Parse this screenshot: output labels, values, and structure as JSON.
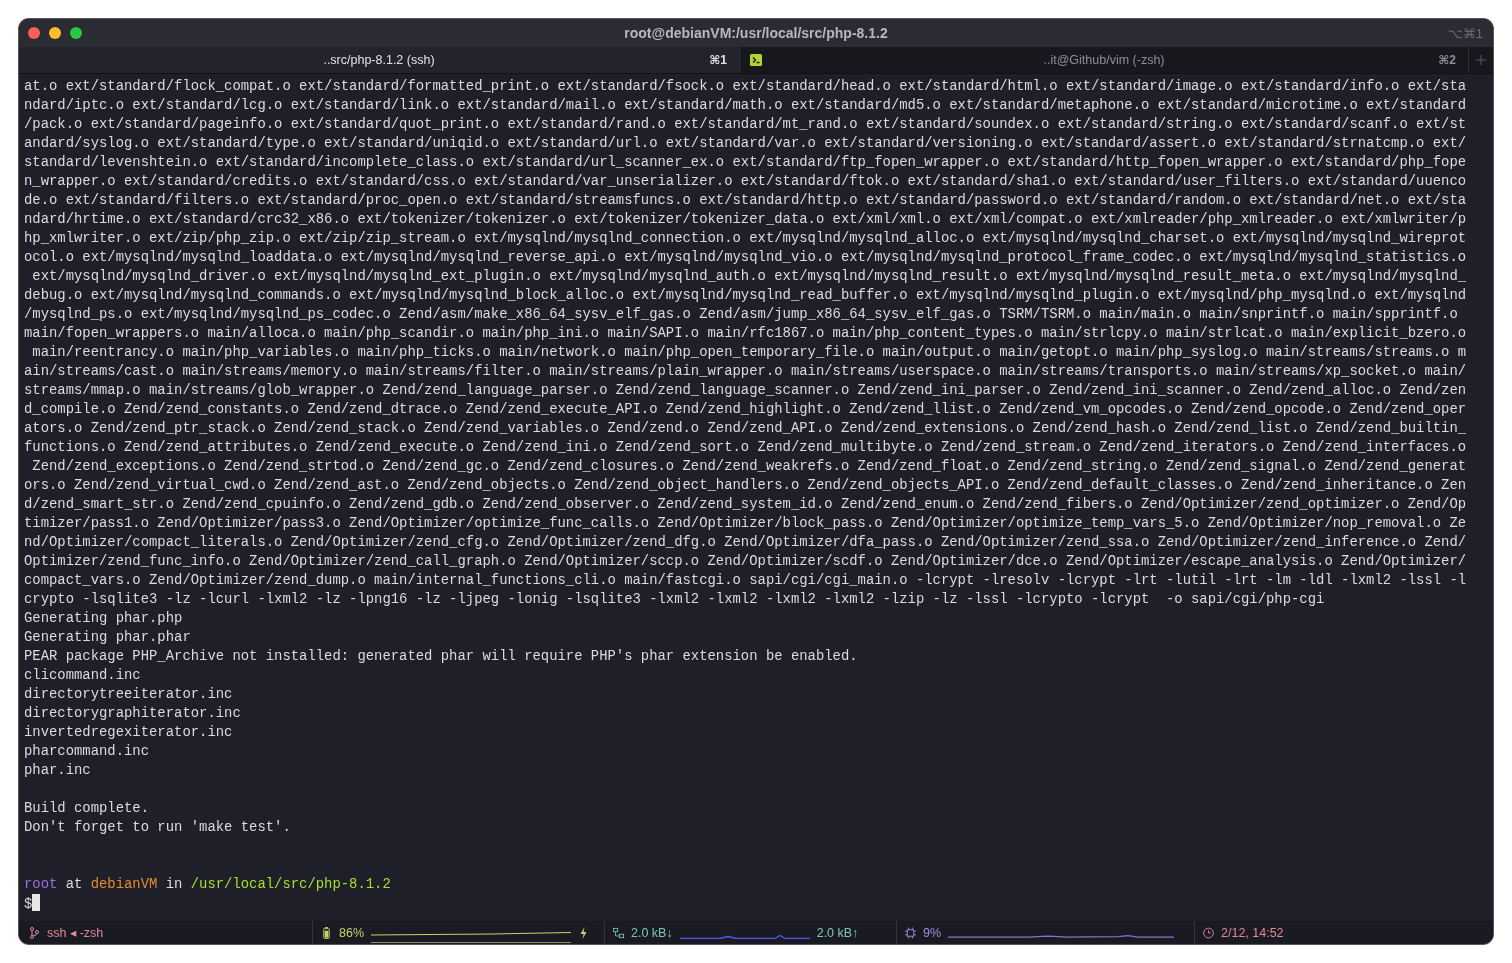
{
  "window": {
    "title": "root@debianVM:/usr/local/src/php-8.1.2",
    "shortcut": "⌥⌘1"
  },
  "tabs": [
    {
      "title": "..src/php-8.1.2 (ssh)",
      "shortcut": "⌘1",
      "selected": true,
      "kind": "plain"
    },
    {
      "title": "..it@Github/vim (-zsh)",
      "shortcut": "⌘2",
      "selected": false,
      "kind": "terminal"
    }
  ],
  "output_lines": [
    "at.o ext/standard/flock_compat.o ext/standard/formatted_print.o ext/standard/fsock.o ext/standard/head.o ext/standard/html.o ext/standard/image.o ext/standard/info.o ext/sta",
    "ndard/iptc.o ext/standard/lcg.o ext/standard/link.o ext/standard/mail.o ext/standard/math.o ext/standard/md5.o ext/standard/metaphone.o ext/standard/microtime.o ext/standard",
    "/pack.o ext/standard/pageinfo.o ext/standard/quot_print.o ext/standard/rand.o ext/standard/mt_rand.o ext/standard/soundex.o ext/standard/string.o ext/standard/scanf.o ext/st",
    "andard/syslog.o ext/standard/type.o ext/standard/uniqid.o ext/standard/url.o ext/standard/var.o ext/standard/versioning.o ext/standard/assert.o ext/standard/strnatcmp.o ext/",
    "standard/levenshtein.o ext/standard/incomplete_class.o ext/standard/url_scanner_ex.o ext/standard/ftp_fopen_wrapper.o ext/standard/http_fopen_wrapper.o ext/standard/php_fope",
    "n_wrapper.o ext/standard/credits.o ext/standard/css.o ext/standard/var_unserializer.o ext/standard/ftok.o ext/standard/sha1.o ext/standard/user_filters.o ext/standard/uuenco",
    "de.o ext/standard/filters.o ext/standard/proc_open.o ext/standard/streamsfuncs.o ext/standard/http.o ext/standard/password.o ext/standard/random.o ext/standard/net.o ext/sta",
    "ndard/hrtime.o ext/standard/crc32_x86.o ext/tokenizer/tokenizer.o ext/tokenizer/tokenizer_data.o ext/xml/xml.o ext/xml/compat.o ext/xmlreader/php_xmlreader.o ext/xmlwriter/p",
    "hp_xmlwriter.o ext/zip/php_zip.o ext/zip/zip_stream.o ext/mysqlnd/mysqlnd_connection.o ext/mysqlnd/mysqlnd_alloc.o ext/mysqlnd/mysqlnd_charset.o ext/mysqlnd/mysqlnd_wireprot",
    "ocol.o ext/mysqlnd/mysqlnd_loaddata.o ext/mysqlnd/mysqlnd_reverse_api.o ext/mysqlnd/mysqlnd_vio.o ext/mysqlnd/mysqlnd_protocol_frame_codec.o ext/mysqlnd/mysqlnd_statistics.o",
    " ext/mysqlnd/mysqlnd_driver.o ext/mysqlnd/mysqlnd_ext_plugin.o ext/mysqlnd/mysqlnd_auth.o ext/mysqlnd/mysqlnd_result.o ext/mysqlnd/mysqlnd_result_meta.o ext/mysqlnd/mysqlnd_",
    "debug.o ext/mysqlnd/mysqlnd_commands.o ext/mysqlnd/mysqlnd_block_alloc.o ext/mysqlnd/mysqlnd_read_buffer.o ext/mysqlnd/mysqlnd_plugin.o ext/mysqlnd/php_mysqlnd.o ext/mysqlnd",
    "/mysqlnd_ps.o ext/mysqlnd/mysqlnd_ps_codec.o Zend/asm/make_x86_64_sysv_elf_gas.o Zend/asm/jump_x86_64_sysv_elf_gas.o TSRM/TSRM.o main/main.o main/snprintf.o main/spprintf.o",
    "main/fopen_wrappers.o main/alloca.o main/php_scandir.o main/php_ini.o main/SAPI.o main/rfc1867.o main/php_content_types.o main/strlcpy.o main/strlcat.o main/explicit_bzero.o",
    " main/reentrancy.o main/php_variables.o main/php_ticks.o main/network.o main/php_open_temporary_file.o main/output.o main/getopt.o main/php_syslog.o main/streams/streams.o m",
    "ain/streams/cast.o main/streams/memory.o main/streams/filter.o main/streams/plain_wrapper.o main/streams/userspace.o main/streams/transports.o main/streams/xp_socket.o main/",
    "streams/mmap.o main/streams/glob_wrapper.o Zend/zend_language_parser.o Zend/zend_language_scanner.o Zend/zend_ini_parser.o Zend/zend_ini_scanner.o Zend/zend_alloc.o Zend/zen",
    "d_compile.o Zend/zend_constants.o Zend/zend_dtrace.o Zend/zend_execute_API.o Zend/zend_highlight.o Zend/zend_llist.o Zend/zend_vm_opcodes.o Zend/zend_opcode.o Zend/zend_oper",
    "ators.o Zend/zend_ptr_stack.o Zend/zend_stack.o Zend/zend_variables.o Zend/zend.o Zend/zend_API.o Zend/zend_extensions.o Zend/zend_hash.o Zend/zend_list.o Zend/zend_builtin_",
    "functions.o Zend/zend_attributes.o Zend/zend_execute.o Zend/zend_ini.o Zend/zend_sort.o Zend/zend_multibyte.o Zend/zend_stream.o Zend/zend_iterators.o Zend/zend_interfaces.o",
    " Zend/zend_exceptions.o Zend/zend_strtod.o Zend/zend_gc.o Zend/zend_closures.o Zend/zend_weakrefs.o Zend/zend_float.o Zend/zend_string.o Zend/zend_signal.o Zend/zend_generat",
    "ors.o Zend/zend_virtual_cwd.o Zend/zend_ast.o Zend/zend_objects.o Zend/zend_object_handlers.o Zend/zend_objects_API.o Zend/zend_default_classes.o Zend/zend_inheritance.o Zen",
    "d/zend_smart_str.o Zend/zend_cpuinfo.o Zend/zend_gdb.o Zend/zend_observer.o Zend/zend_system_id.o Zend/zend_enum.o Zend/zend_fibers.o Zend/Optimizer/zend_optimizer.o Zend/Op",
    "timizer/pass1.o Zend/Optimizer/pass3.o Zend/Optimizer/optimize_func_calls.o Zend/Optimizer/block_pass.o Zend/Optimizer/optimize_temp_vars_5.o Zend/Optimizer/nop_removal.o Ze",
    "nd/Optimizer/compact_literals.o Zend/Optimizer/zend_cfg.o Zend/Optimizer/zend_dfg.o Zend/Optimizer/dfa_pass.o Zend/Optimizer/zend_ssa.o Zend/Optimizer/zend_inference.o Zend/",
    "Optimizer/zend_func_info.o Zend/Optimizer/zend_call_graph.o Zend/Optimizer/sccp.o Zend/Optimizer/scdf.o Zend/Optimizer/dce.o Zend/Optimizer/escape_analysis.o Zend/Optimizer/",
    "compact_vars.o Zend/Optimizer/zend_dump.o main/internal_functions_cli.o main/fastcgi.o sapi/cgi/cgi_main.o -lcrypt -lresolv -lcrypt -lrt -lutil -lrt -lm -ldl -lxml2 -lssl -l",
    "crypto -lsqlite3 -lz -lcurl -lxml2 -lz -lpng16 -lz -ljpeg -lonig -lsqlite3 -lxml2 -lxml2 -lxml2 -lxml2 -lzip -lz -lssl -lcrypto -lcrypt  -o sapi/cgi/php-cgi",
    "Generating phar.php",
    "Generating phar.phar",
    "PEAR package PHP_Archive not installed: generated phar will require PHP's phar extension be enabled.",
    "clicommand.inc",
    "directorytreeiterator.inc",
    "directorygraphiterator.inc",
    "invertedregexiterator.inc",
    "pharcommand.inc",
    "phar.inc"
  ],
  "build_messages": [
    "Build complete.",
    "Don't forget to run 'make test'."
  ],
  "prompt": {
    "user": "root",
    "at": "at",
    "host": "debianVM",
    "in": "in",
    "path": "/usr/local/src/php-8.1.2",
    "symbol": "$"
  },
  "status_bar": {
    "session": "ssh ◂ -zsh",
    "battery": "86%",
    "net_down": "2.0 kB↓",
    "net_up": "2.0 kB↑",
    "cpu": "9%",
    "clock": "2/12, 14:52"
  }
}
